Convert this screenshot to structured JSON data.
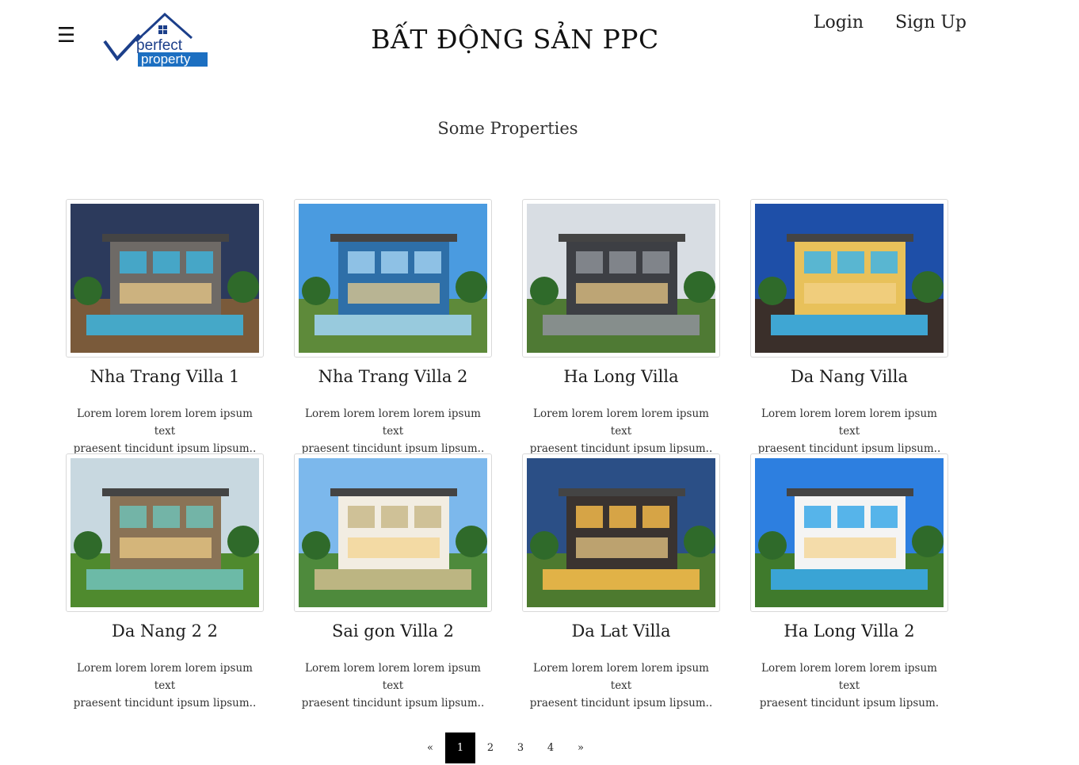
{
  "header": {
    "menu_icon": "☰",
    "logo": {
      "line1": "perfect",
      "line2": "property"
    },
    "title": "BẤT ĐỘNG SẢN PPC",
    "login_label": "Login",
    "signup_label": "Sign Up"
  },
  "section_title": "Some Properties",
  "properties": [
    {
      "title": "Nha Trang Villa 1",
      "description": "Lorem lorem lorem lorem ipsum text\npraesent tincidunt ipsum lipsum..",
      "sky": "#2c3a5c",
      "wall": "#6e6a66",
      "ground": "#7a5a3a",
      "accent": "#3fb0d8"
    },
    {
      "title": "Nha Trang Villa 2",
      "description": "Lorem lorem lorem lorem ipsum text\npraesent tincidunt ipsum lipsum..",
      "sky": "#4a9be0",
      "wall": "#2e6fa8",
      "ground": "#5e8a3a",
      "accent": "#9fd0f0"
    },
    {
      "title": "Ha Long Villa",
      "description": "Lorem lorem lorem lorem ipsum text\npraesent tincidunt ipsum lipsum..",
      "sky": "#d8dde3",
      "wall": "#3d3f44",
      "ground": "#4f7a34",
      "accent": "#8c9096"
    },
    {
      "title": "Da Nang Villa",
      "description": "Lorem lorem lorem lorem ipsum text\npraesent tincidunt ipsum lipsum..",
      "sky": "#1e4fa8",
      "wall": "#e8c15a",
      "ground": "#3a2f2a",
      "accent": "#40b4e6"
    },
    {
      "title": "Da Nang 2 2",
      "description": "Lorem lorem lorem lorem ipsum text\npraesent tincidunt ipsum lipsum..",
      "sky": "#c8d8e0",
      "wall": "#8a7356",
      "ground": "#4f8a2e",
      "accent": "#6fbfb5"
    },
    {
      "title": "Sai gon Villa 2",
      "description": "Lorem lorem lorem lorem ipsum text\npraesent tincidunt ipsum lipsum..",
      "sky": "#7cb8ec",
      "wall": "#f2ede2",
      "ground": "#4e8a3c",
      "accent": "#c9b98a"
    },
    {
      "title": "Da Lat Villa",
      "description": "Lorem lorem lorem lorem ipsum text\npraesent tincidunt ipsum lipsum..",
      "sky": "#2b4f86",
      "wall": "#3a3330",
      "ground": "#4d7a2f",
      "accent": "#f2b84a"
    },
    {
      "title": "Ha Long Villa 2",
      "description": "Lorem lorem lorem lorem ipsum text\npraesent tincidunt ipsum lipsum.",
      "sky": "#2d7fe0",
      "wall": "#f4f4f4",
      "ground": "#3f7a2c",
      "accent": "#3aa8e8"
    }
  ],
  "pagination": {
    "prev": "«",
    "pages": [
      "1",
      "2",
      "3",
      "4"
    ],
    "next": "»",
    "active_page": "1"
  }
}
